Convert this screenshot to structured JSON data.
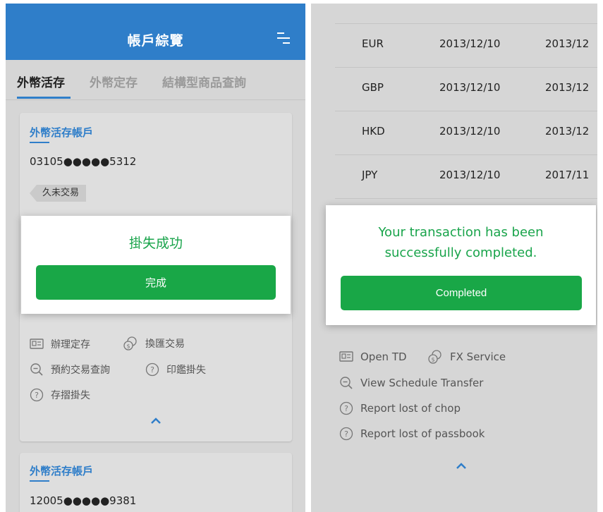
{
  "left": {
    "header": {
      "title": "帳戶綜覽"
    },
    "tabs": [
      {
        "label": "外幣活存"
      },
      {
        "label": "外幣定存"
      },
      {
        "label": "結構型商品查詢"
      }
    ],
    "account1": {
      "title": "外幣活存帳戶",
      "number_prefix": "03105",
      "number_mask": "●●●●●",
      "number_suffix": "5312",
      "tag": "久未交易"
    },
    "modal": {
      "message": "掛失成功",
      "button": "完成"
    },
    "actions": {
      "open_td": "辦理定存",
      "fx_service": "換匯交易",
      "schedule": "預約交易查詢",
      "lost_chop": "印鑑掛失",
      "lost_passbook": "存摺掛失"
    },
    "account2": {
      "title": "外幣活存帳戶",
      "number_prefix": "12005",
      "number_mask": "●●●●●",
      "number_suffix": "9381"
    }
  },
  "right": {
    "rates": [
      {
        "currency": "EUR",
        "date1": "2013/12/10",
        "date2": "2013/12"
      },
      {
        "currency": "GBP",
        "date1": "2013/12/10",
        "date2": "2013/12"
      },
      {
        "currency": "HKD",
        "date1": "2013/12/10",
        "date2": "2013/12"
      },
      {
        "currency": "JPY",
        "date1": "2013/12/10",
        "date2": "2017/11"
      }
    ],
    "modal": {
      "line1": "Your transaction has been",
      "line2": "successfully completed.",
      "button": "Completed"
    },
    "actions": {
      "open_td": "Open TD",
      "fx_service": "FX Service",
      "schedule": "View Schedule Transfer",
      "lost_chop": "Report lost of chop",
      "lost_passbook": "Report lost of passbook"
    }
  },
  "colors": {
    "brand_blue": "#2f7ec9",
    "success_green": "#19a747",
    "message_green": "#19a44b"
  },
  "icons": [
    "menu-icon",
    "deposit-icon",
    "exchange-icon",
    "search-icon",
    "help-icon",
    "chevron-up-icon"
  ]
}
